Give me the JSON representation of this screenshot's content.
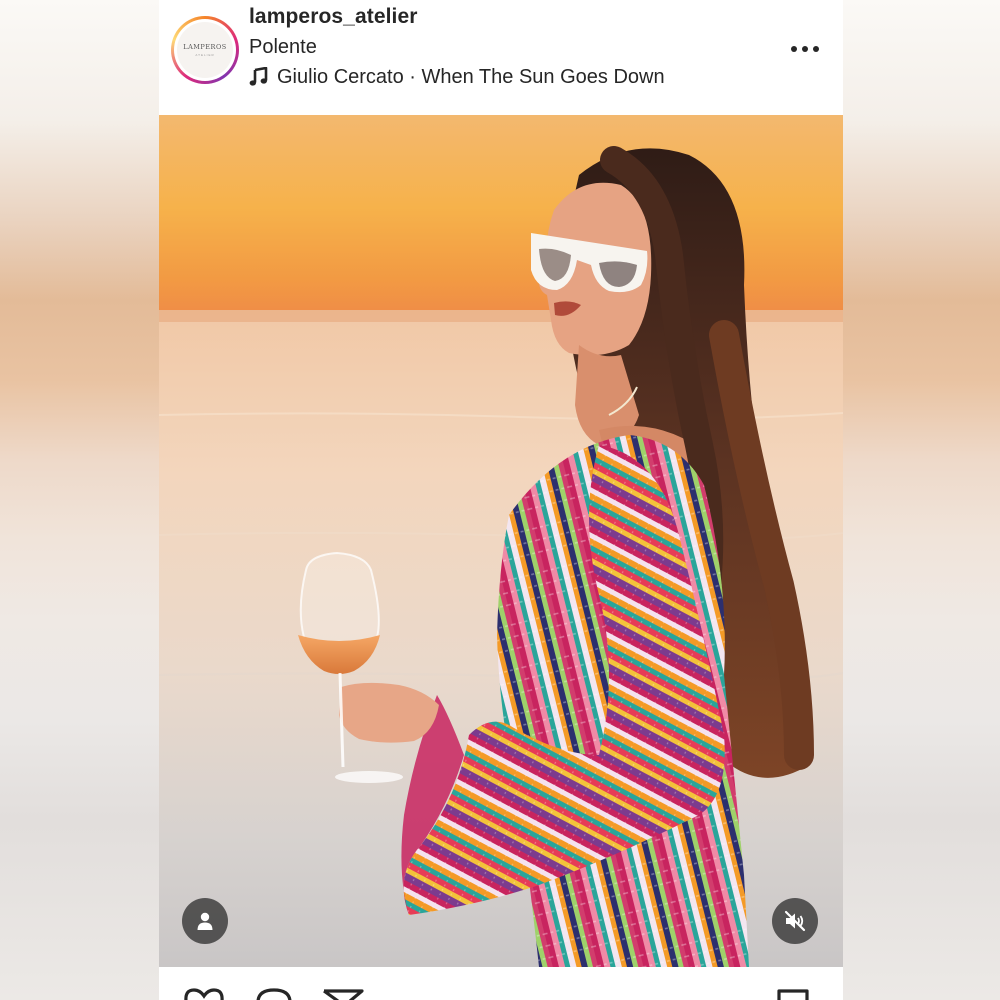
{
  "post": {
    "username": "lamperos_atelier",
    "location": "Polente",
    "music": "Giulio Cercato · When The Sun Goes Down",
    "avatar": {
      "logo_text": "LAMPEROS",
      "logo_subtext": "ATELIER"
    }
  },
  "media": {
    "description_icons": {
      "user_tag": "person-icon",
      "audio": "muted-speaker-icon"
    }
  },
  "actions": {
    "icons": [
      "heart-icon",
      "comment-icon",
      "share-icon",
      "bookmark-icon"
    ]
  },
  "colors": {
    "ring_start": "#f58529",
    "ring_mid": "#dd2a7b",
    "ring_end": "#8134af",
    "text": "#262626",
    "overlay_button": "#262626"
  }
}
